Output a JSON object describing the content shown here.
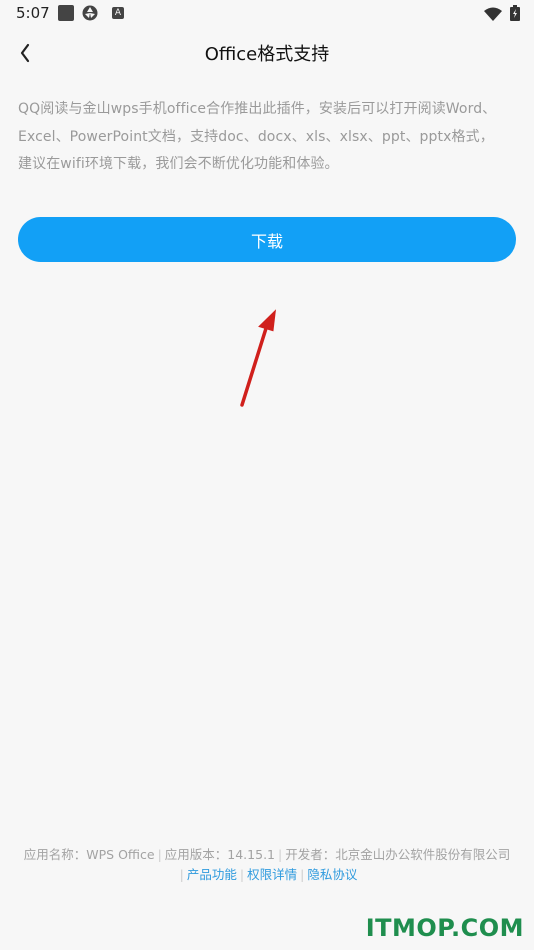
{
  "status_bar": {
    "time": "5:07",
    "icons": [
      "square-icon",
      "aperture-icon",
      "font-a-icon",
      "wifi-icon",
      "battery-charging-icon"
    ]
  },
  "header": {
    "title": "Office格式支持",
    "back_icon": "chevron-left-icon"
  },
  "description": "QQ阅读与金山wps手机office合作推出此插件，安装后可以打开阅读Word、Excel、PowerPoint文档，支持doc、docx、xls、xlsx、ppt、pptx格式，建议在wifi环境下载，我们会不断优化功能和体验。",
  "download": {
    "label": "下载",
    "color": "#12a0f6"
  },
  "footer": {
    "app_name": "应用名称：WPS Office",
    "app_version": "应用版本：14.15.1",
    "developer": "开发者：北京金山办公软件股份有限公司",
    "links": {
      "features": "产品功能",
      "permissions": "权限详情",
      "privacy": "隐私协议"
    },
    "link_color": "#2f9bde"
  },
  "annotation": {
    "arrow_color": "#d0201c",
    "icon": "red-arrow-icon"
  },
  "watermark": "ITMOP.COM"
}
